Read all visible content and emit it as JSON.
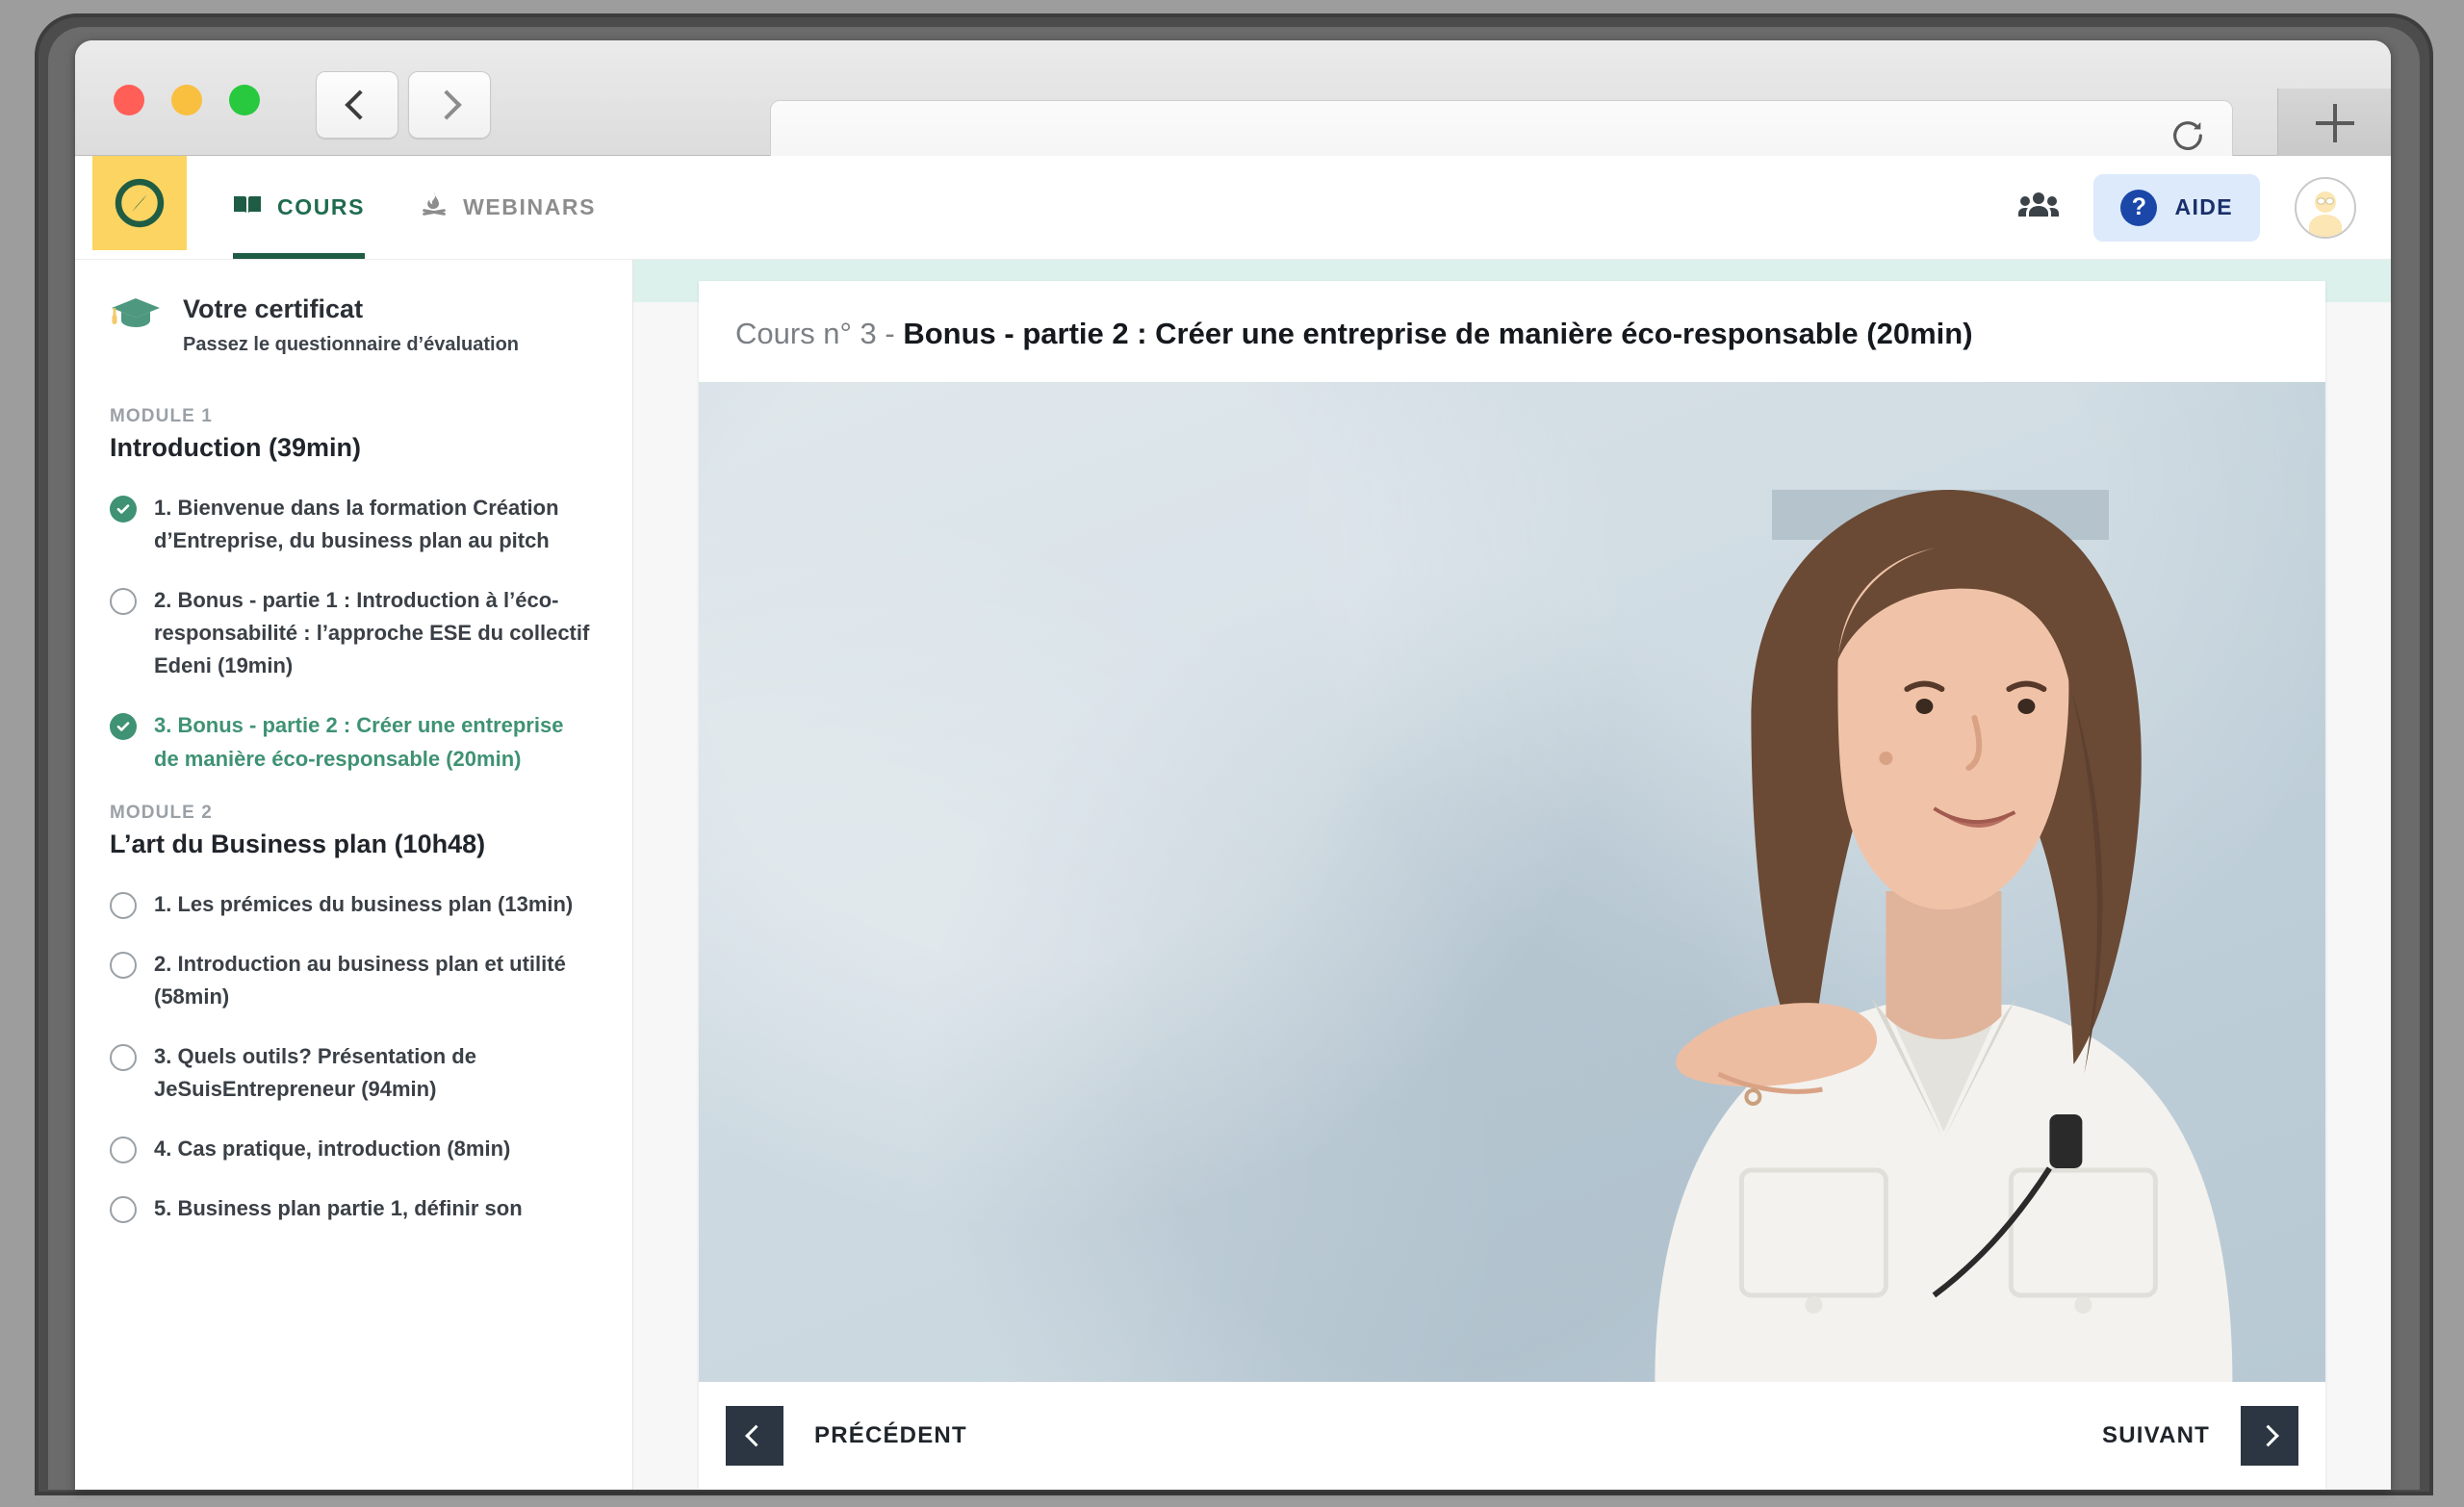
{
  "browser": {
    "window_controls": [
      "close",
      "minimize",
      "maximize"
    ],
    "back_label": "Back",
    "forward_label": "Forward",
    "url_value": "",
    "url_placeholder": "",
    "reload_label": "Reload",
    "new_tab_label": "New Tab"
  },
  "appnav": {
    "logo_name": "compass-logo",
    "logo_bg": "#fcd462",
    "logo_color": "#1f5c44",
    "tabs": [
      {
        "label": "COURS",
        "icon": "book-icon",
        "active": true
      },
      {
        "label": "WEBINARS",
        "icon": "campfire-icon",
        "active": false
      }
    ],
    "community_icon": "community-icon",
    "help": {
      "label": "AIDE",
      "icon": "question-mark-icon",
      "bg": "#ddeafb",
      "color": "#1a2f6b"
    },
    "avatar_label": "User avatar"
  },
  "sidebar": {
    "certificate": {
      "icon": "graduation-cap-icon",
      "title": "Votre certificat",
      "subtitle": "Passez le questionnaire d’évaluation"
    },
    "modules": [
      {
        "kicker": "MODULE 1",
        "title": "Introduction (39min)",
        "lessons": [
          {
            "state": "done",
            "text": "1. Bienvenue dans la formation Création d’Entreprise, du business plan au pitch"
          },
          {
            "state": "todo",
            "text": "2. Bonus - partie 1 : Introduction à l’éco-responsabilité : l’approche ESE du collectif Edeni (19min)"
          },
          {
            "state": "current",
            "text": "3. Bonus - partie 2 : Créer une entreprise de manière éco-responsable (20min)"
          }
        ]
      },
      {
        "kicker": "MODULE 2",
        "title": "L’art du Business plan (10h48)",
        "lessons": [
          {
            "state": "todo",
            "text": "1. Les prémices du business plan (13min)"
          },
          {
            "state": "todo",
            "text": "2. Introduction au business plan et utilité (58min)"
          },
          {
            "state": "todo",
            "text": "3. Quels outils? Présentation de JeSuisEntrepreneur (94min)"
          },
          {
            "state": "todo",
            "text": "4. Cas pratique, introduction (8min)"
          },
          {
            "state": "todo",
            "text": "5. Business plan partie 1, définir son"
          }
        ]
      }
    ]
  },
  "content": {
    "course_prefix": "Cours n° 3 - ",
    "course_title": "Bonus - partie 2 : Créer une entreprise de manière éco-responsable (20min)",
    "video_alt": "Formatrice parlant devant un mur gris",
    "nav": {
      "prev_label": "PRÉCÉDENT",
      "next_label": "SUIVANT"
    }
  },
  "colors": {
    "brand_green": "#1f5c44",
    "accent_green": "#3f9274",
    "brand_yellow": "#fcd462",
    "mint_band": "#ddf1ec",
    "help_blue": "#1a47a8",
    "nav_dark": "#2b3642"
  }
}
